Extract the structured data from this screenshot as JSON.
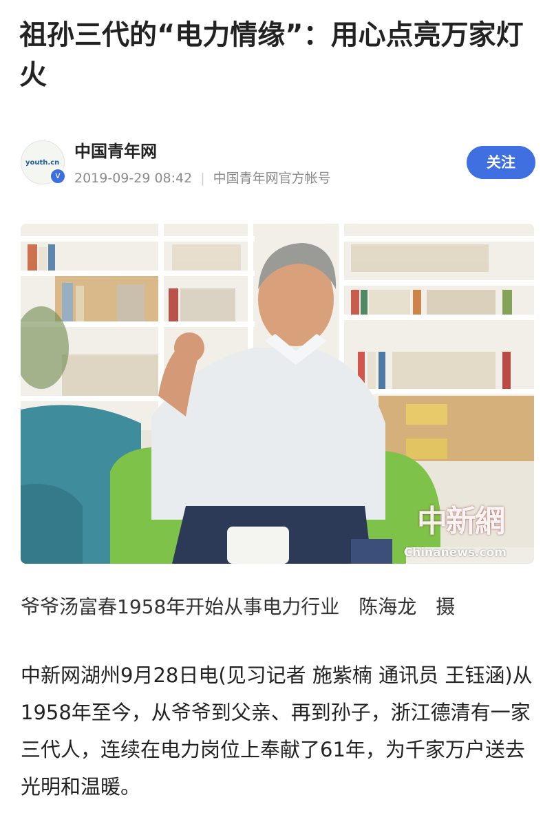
{
  "article": {
    "title": "祖孙三代的“电力情缘”：用心点亮万家灯火",
    "author": {
      "name": "中国青年网",
      "avatar_text": "youth.cn",
      "date": "2019-09-29 08:42",
      "account_type": "中国青年网官方帐号",
      "follow_label": "关注"
    },
    "photo": {
      "watermark_cn": "中新網",
      "watermark_en": "Chinanews.com"
    },
    "caption": {
      "text": "爷爷汤富春1958年开始从事电力行业",
      "credit": "陈海龙",
      "credit_tail": "摄"
    },
    "body": "中新网湖州9月28日电(见习记者 施紫楠 通讯员 王钰涵)从1958年至今，从爷爷到父亲、再到孙子，浙江德清有一家三代人，连续在电力岗位上奉献了61年，为千家万户送去光明和温暖。"
  },
  "colors": {
    "accent": "#3f6fe0",
    "meta_text": "#8a8a8a"
  }
}
